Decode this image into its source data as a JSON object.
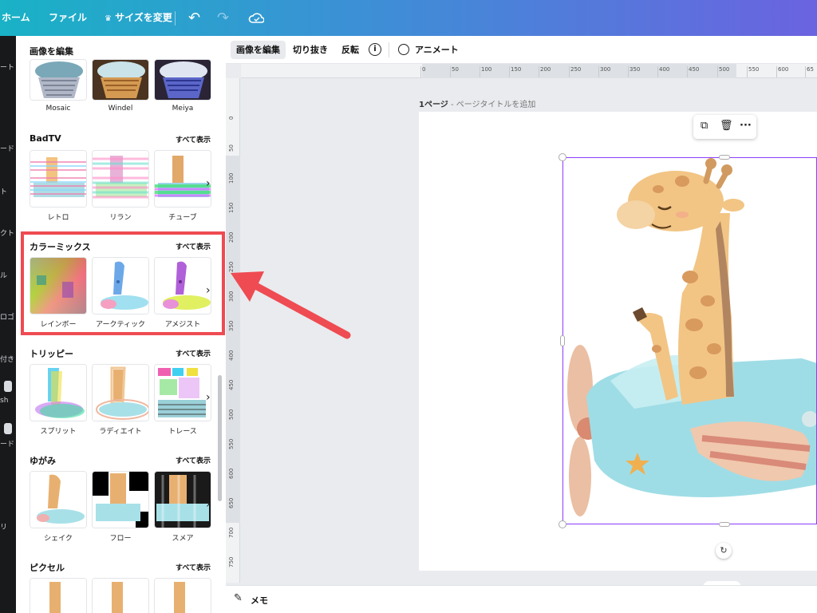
{
  "topbar": {
    "home": "ホーム",
    "file": "ファイル",
    "resize": "サイズを変更",
    "resize_icon": "crown-icon",
    "undo_icon": "undo-icon",
    "redo_icon": "redo-icon",
    "cloud_icon": "cloud-saved-icon"
  },
  "rail": {
    "items": [
      "ート",
      "ード",
      "ト",
      "クト",
      "ル",
      "ロゴ",
      "付き",
      "sh",
      "ード",
      "リ"
    ]
  },
  "panel": {
    "title": "画像を編集",
    "show_all": "すべて表示",
    "top_row": [
      "Mosaic",
      "Windel",
      "Meiya"
    ],
    "sections": [
      {
        "title": "BadTV",
        "items": [
          "レトロ",
          "リラン",
          "チューブ"
        ]
      },
      {
        "title": "カラーミックス",
        "items": [
          "レインボー",
          "アークティック",
          "アメジスト"
        ]
      },
      {
        "title": "トリッピー",
        "items": [
          "スプリット",
          "ラディエイト",
          "トレース"
        ]
      },
      {
        "title": "ゆがみ",
        "items": [
          "シェイク",
          "フロー",
          "スメア"
        ]
      },
      {
        "title": "ピクセル",
        "items": []
      }
    ]
  },
  "toolbar": {
    "edit_image": "画像を編集",
    "crop": "切り抜き",
    "flip": "反転",
    "info": "i",
    "animate": "アニメート"
  },
  "ruler": {
    "h": [
      "0",
      "50",
      "100",
      "150",
      "200",
      "250",
      "300",
      "350",
      "400",
      "450",
      "500",
      "550",
      "600",
      "65"
    ],
    "v": [
      "0",
      "50",
      "100",
      "150",
      "200",
      "250",
      "300",
      "350",
      "400",
      "450",
      "500",
      "550",
      "600",
      "650",
      "700",
      "750"
    ]
  },
  "canvas": {
    "page_label": "1ページ",
    "page_title_placeholder": " - ページタイトルを追加"
  },
  "float_menu": {
    "icons": [
      "duplicate-icon",
      "trash-icon",
      "more-icon"
    ]
  },
  "notes": {
    "label": "メモ",
    "icon": "notes-icon"
  },
  "colors": {
    "highlight": "#ef4b52",
    "selection": "#8b3dff",
    "header_start": "#19b2c6",
    "header_end": "#6b63e0"
  }
}
